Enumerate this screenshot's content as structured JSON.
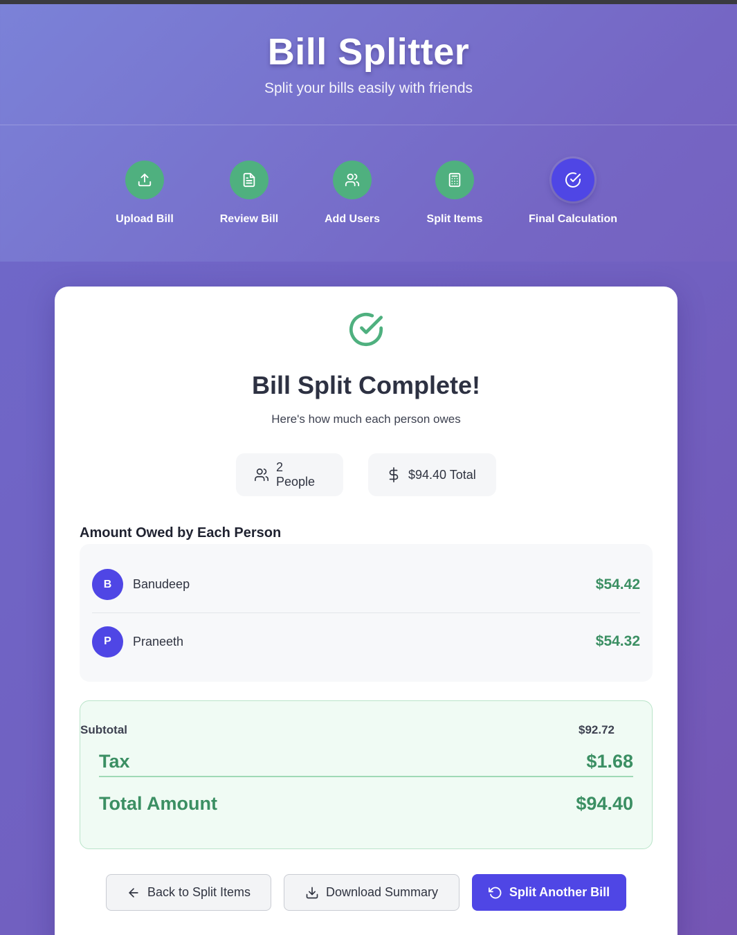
{
  "header": {
    "title": "Bill Splitter",
    "subtitle": "Split your bills easily with friends"
  },
  "steps": [
    {
      "label": "Upload Bill",
      "icon": "upload-icon",
      "status": "complete"
    },
    {
      "label": "Review Bill",
      "icon": "document-icon",
      "status": "complete"
    },
    {
      "label": "Add Users",
      "icon": "users-icon",
      "status": "complete"
    },
    {
      "label": "Split Items",
      "icon": "calculator-icon",
      "status": "complete"
    },
    {
      "label": "Final Calculation",
      "icon": "check-circle-icon",
      "status": "active"
    }
  ],
  "result": {
    "title": "Bill Split Complete!",
    "subtitle": "Here's how much each person owes",
    "people_count": "2 People",
    "total": "$94.40 Total"
  },
  "owed": {
    "title": "Amount Owed by Each Person",
    "people": [
      {
        "initial": "B",
        "name": "Banudeep",
        "amount": "$54.42"
      },
      {
        "initial": "P",
        "name": "Praneeth",
        "amount": "$54.32"
      }
    ]
  },
  "summary": {
    "subtotal_label": "Subtotal",
    "subtotal_value": "$92.72",
    "tax_label": "Tax",
    "tax_value": "$1.68",
    "total_label": "Total Amount",
    "total_value": "$94.40"
  },
  "buttons": {
    "back": "Back to Split Items",
    "download": "Download Summary",
    "again": "Split Another Bill"
  },
  "colors": {
    "accent": "#4f46e5",
    "success": "#4fb07f",
    "amount_text": "#3b8f63"
  }
}
